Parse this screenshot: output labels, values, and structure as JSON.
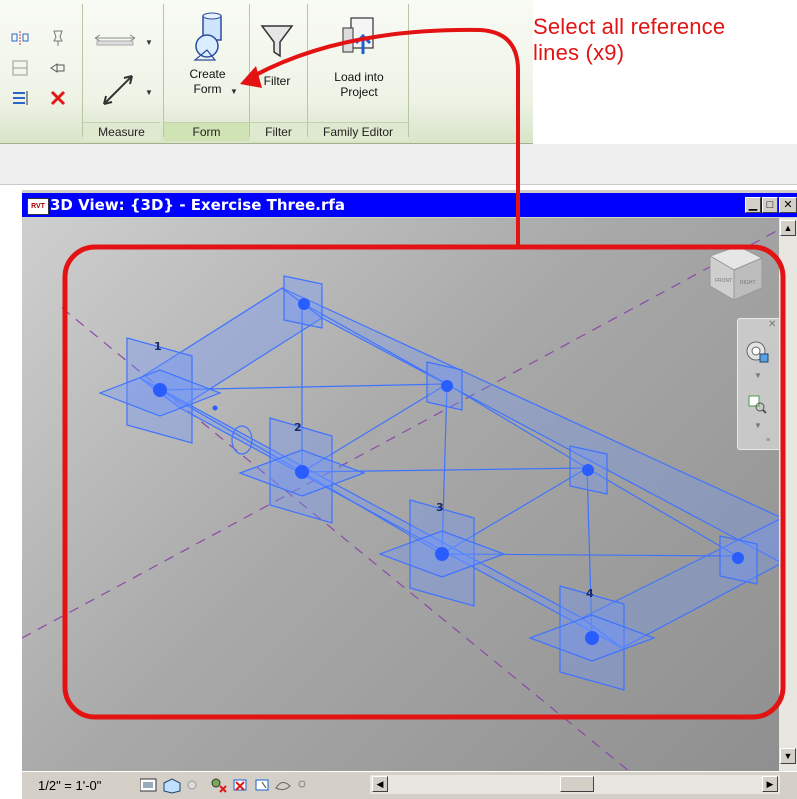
{
  "ribbon": {
    "panels": [
      {
        "name": "Measure",
        "active": false
      },
      {
        "name": "Form",
        "active": true
      },
      {
        "name": "Filter",
        "active": false
      },
      {
        "name": "Family Editor",
        "active": false
      }
    ],
    "buttons": {
      "create_form": "Create Form",
      "create_form_line1": "Create",
      "create_form_line2": "Form",
      "filter": "Filter",
      "load_line1": "Load into",
      "load_line2": "Project"
    }
  },
  "annotation": {
    "line1": "Select all reference",
    "line2": "lines (x9)",
    "color": "#e41313"
  },
  "view": {
    "title": "3D View: {3D} - Exercise Three.rfa",
    "icon_label": "RVT",
    "scale": "1/2\" = 1'-0\"",
    "markers": [
      "1",
      "2",
      "3",
      "4"
    ],
    "viewcube_faces": [
      "FRONT",
      "RIGHT"
    ]
  },
  "colors": {
    "titlebar": "#0000ff",
    "annotation_red": "#e41313",
    "reference_lines": "#2f6bff",
    "ribbon_bg": "#eef3e6"
  },
  "icons": [
    "create-form-icon",
    "filter-icon",
    "load-into-project-icon",
    "measure-icon",
    "delete-icon",
    "viewcube-icon",
    "steering-wheel-icon",
    "zoom-icon"
  ]
}
